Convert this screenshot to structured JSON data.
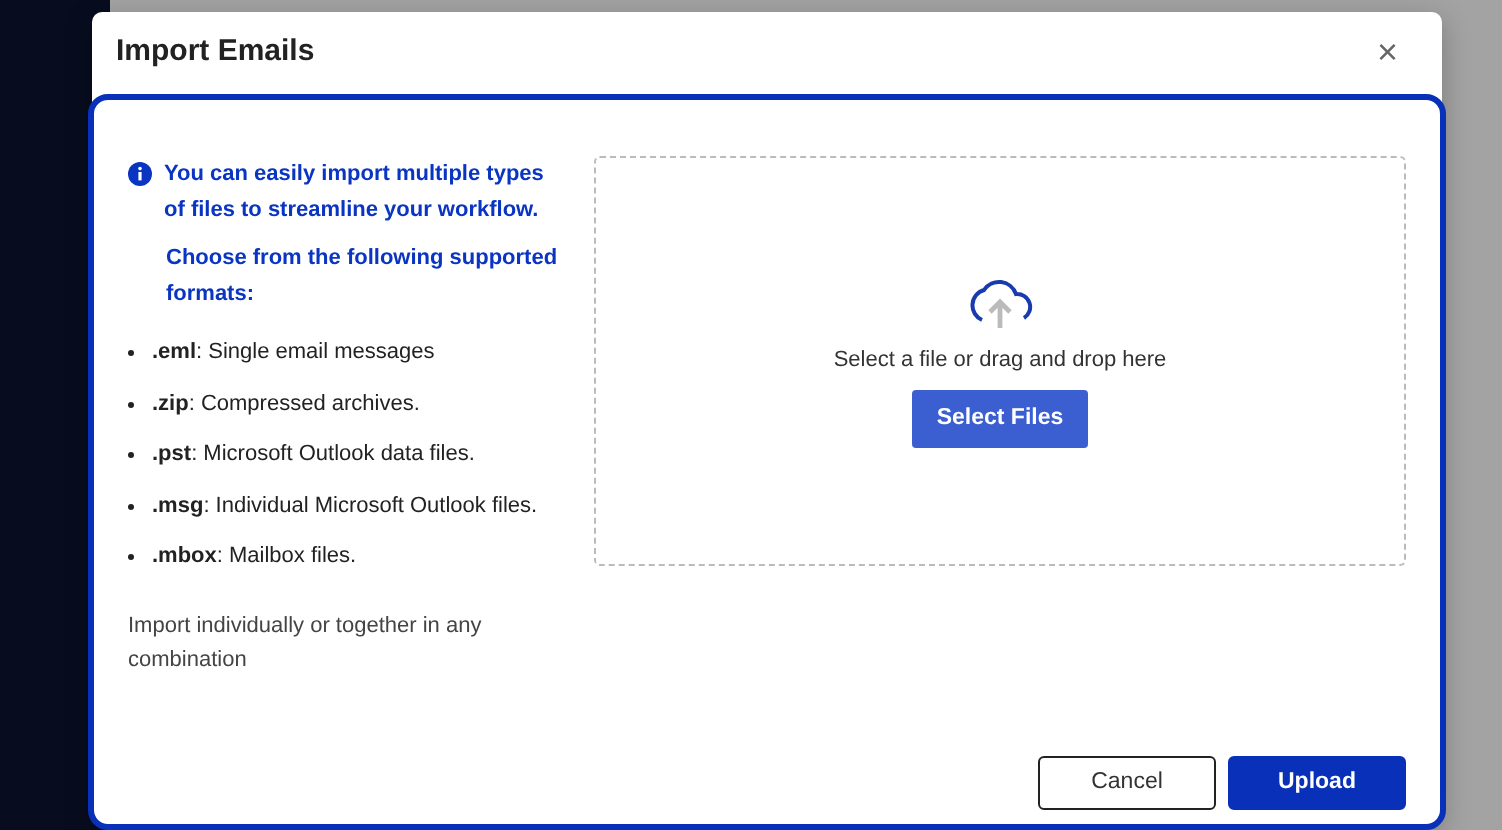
{
  "dialog": {
    "title": "Import Emails",
    "close": "×"
  },
  "info": {
    "intro": "You can easily import multiple types of files to streamline your workflow.",
    "subheading": "Choose from the following supported formats:",
    "formats": [
      "**.eml**: Single email messages",
      "**.zip**: Compressed archives.",
      "**.pst**: Microsoft Outlook data files.",
      "**.msg**: Individual Microsoft Outlook files.",
      "**.mbox**: Mailbox files."
    ],
    "note": "Import individually or together in any combination"
  },
  "dropzone": {
    "prompt": "Select a file or drag and drop here",
    "button": "Select Files"
  },
  "buttons": [
    {
      "label": "Cancel",
      "kind": "secondary"
    },
    {
      "label": "Upload",
      "kind": "primary"
    }
  ]
}
